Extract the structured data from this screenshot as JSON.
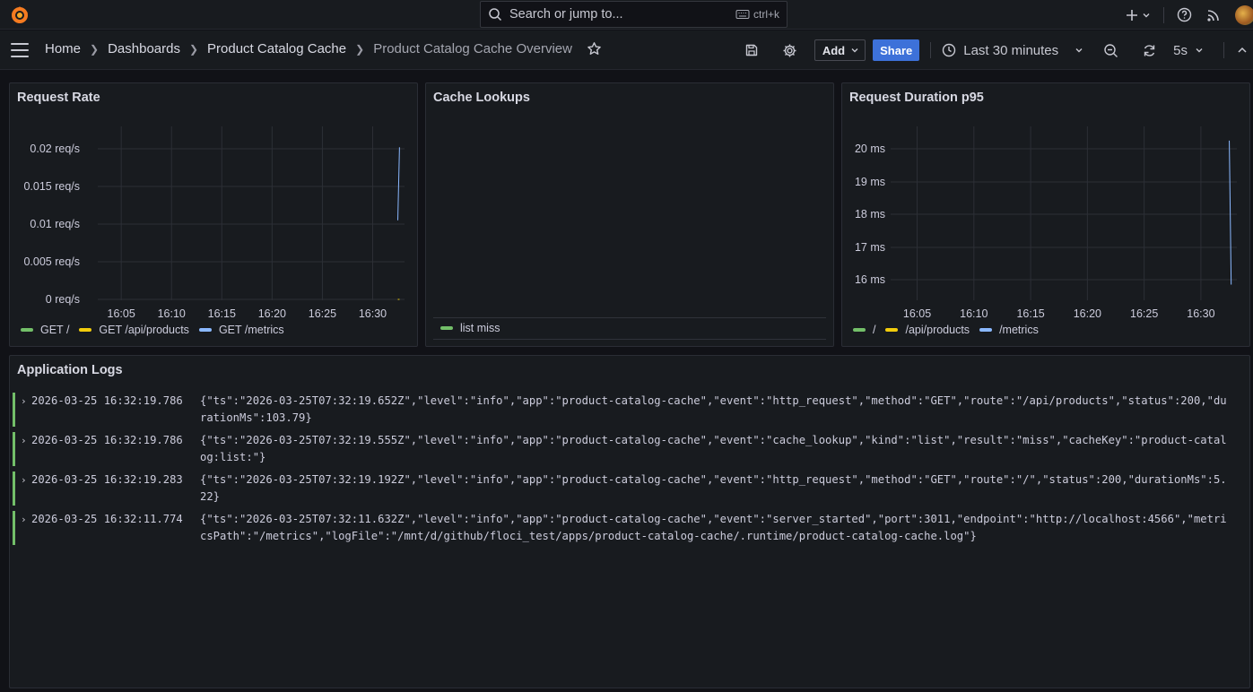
{
  "topbar": {
    "search_placeholder": "Search or jump to...",
    "search_shortcut": "ctrl+k"
  },
  "breadcrumb": {
    "items": [
      "Home",
      "Dashboards",
      "Product Catalog Cache",
      "Product Catalog Cache Overview"
    ]
  },
  "toolbar": {
    "add_label": "Add",
    "share_label": "Share",
    "time_range": "Last 30 minutes",
    "refresh_interval": "5s"
  },
  "colors": {
    "green": "#73bf69",
    "yellow": "#f2cc0c",
    "blue": "#8ab8ff",
    "accent": "#3d71d9"
  },
  "panels": {
    "request_rate": {
      "title": "Request Rate",
      "legend": [
        "GET /",
        "GET /api/products",
        "GET /metrics"
      ]
    },
    "cache_lookups": {
      "title": "Cache Lookups",
      "legend": [
        "list miss"
      ]
    },
    "request_duration": {
      "title": "Request Duration p95",
      "legend": [
        "/",
        "/api/products",
        "/metrics"
      ]
    },
    "logs": {
      "title": "Application Logs",
      "entries": [
        {
          "time": "2026-03-25 16:32:19.786",
          "line": "{\"ts\":\"2026-03-25T07:32:19.652Z\",\"level\":\"info\",\"app\":\"product-catalog-cache\",\"event\":\"http_request\",\"method\":\"GET\",\"route\":\"/api/products\",\"status\":200,\"durationMs\":103.79}"
        },
        {
          "time": "2026-03-25 16:32:19.786",
          "line": "{\"ts\":\"2026-03-25T07:32:19.555Z\",\"level\":\"info\",\"app\":\"product-catalog-cache\",\"event\":\"cache_lookup\",\"kind\":\"list\",\"result\":\"miss\",\"cacheKey\":\"product-catalog:list:\"}"
        },
        {
          "time": "2026-03-25 16:32:19.283",
          "line": "{\"ts\":\"2026-03-25T07:32:19.192Z\",\"level\":\"info\",\"app\":\"product-catalog-cache\",\"event\":\"http_request\",\"method\":\"GET\",\"route\":\"/\",\"status\":200,\"durationMs\":5.22}"
        },
        {
          "time": "2026-03-25 16:32:11.774",
          "line": "{\"ts\":\"2026-03-25T07:32:11.632Z\",\"level\":\"info\",\"app\":\"product-catalog-cache\",\"event\":\"server_started\",\"port\":3011,\"endpoint\":\"http://localhost:4566\",\"metricsPath\":\"/metrics\",\"logFile\":\"/mnt/d/github/floci_test/apps/product-catalog-cache/.runtime/product-catalog-cache.log\"}"
        }
      ]
    }
  },
  "chart_data": [
    {
      "type": "line",
      "title": "Request Rate",
      "x_ticks": [
        "16:05",
        "16:10",
        "16:15",
        "16:20",
        "16:25",
        "16:30"
      ],
      "y_ticks": [
        "0.02 req/s",
        "0.015 req/s",
        "0.01 req/s",
        "0.005 req/s",
        "0 req/s"
      ],
      "ylim": [
        0,
        0.02
      ],
      "series": [
        {
          "name": "GET /",
          "x": [
            "16:32:30",
            "16:32:40"
          ],
          "values": [
            0,
            0
          ]
        },
        {
          "name": "GET /api/products",
          "x": [
            "16:32:30",
            "16:32:40"
          ],
          "values": [
            0,
            0
          ]
        },
        {
          "name": "GET /metrics",
          "x": [
            "16:32:30",
            "16:32:40"
          ],
          "values": [
            0.0105,
            0.0202
          ]
        }
      ],
      "grid": true,
      "legend": "bottom-left"
    },
    {
      "type": "line",
      "title": "Cache Lookups",
      "series": [
        {
          "name": "list miss",
          "values": []
        }
      ],
      "grid": false,
      "legend": "bottom-left"
    },
    {
      "type": "line",
      "title": "Request Duration p95",
      "x_ticks": [
        "16:05",
        "16:10",
        "16:15",
        "16:20",
        "16:25",
        "16:30"
      ],
      "y_ticks": [
        "20 ms",
        "19 ms",
        "18 ms",
        "17 ms",
        "16 ms"
      ],
      "ylim": [
        15.65,
        20.65
      ],
      "series": [
        {
          "name": "/",
          "values": []
        },
        {
          "name": "/api/products",
          "values": []
        },
        {
          "name": "/metrics",
          "x": [
            "16:32:30",
            "16:32:40"
          ],
          "values": [
            20.25,
            15.85
          ]
        }
      ],
      "grid": true,
      "legend": "bottom-left"
    }
  ]
}
